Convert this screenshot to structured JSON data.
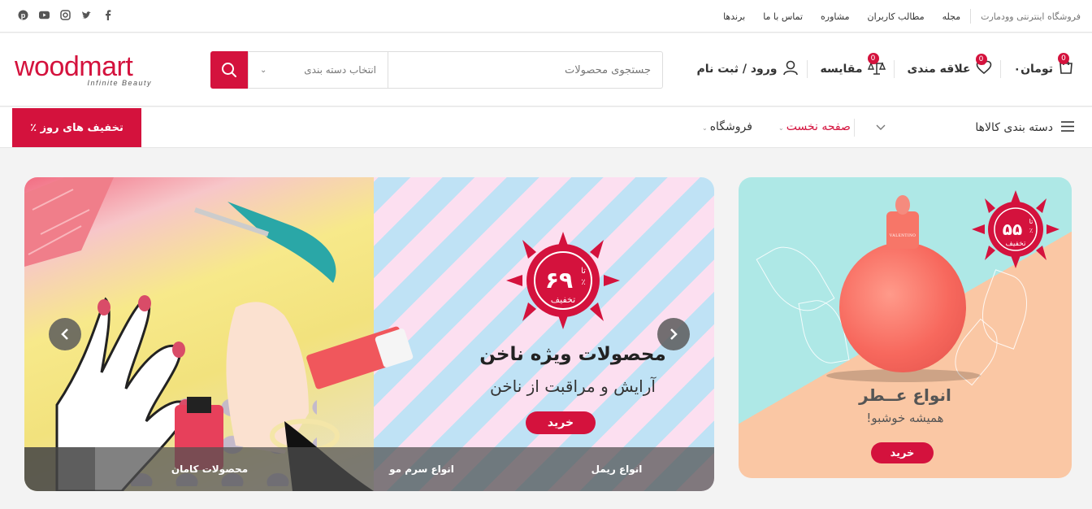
{
  "topbar": {
    "links": [
      "فروشگاه اینترنتی وودمارت",
      "مجله",
      "مطالب کاربران",
      "مشاوره",
      "تماس با ما",
      "برندها"
    ],
    "social_icons": [
      "facebook-icon",
      "twitter-icon",
      "instagram-icon",
      "youtube-icon",
      "pinterest-icon"
    ]
  },
  "header": {
    "logo_word": "woodmart",
    "logo_tagline": "Infinite Beauty",
    "search_placeholder": "جستجوی محصولات",
    "category_select": "انتخاب دسته بندی",
    "cart_label": "۰تومان",
    "cart_count": "0",
    "wishlist_label": "علاقه مندی",
    "wishlist_count": "0",
    "compare_label": "مقایسه",
    "compare_count": "0",
    "account_label": "ورود / ثبت نام"
  },
  "nav": {
    "categories_label": "دسته بندی کالاها",
    "home_label": "صفحه نخست",
    "shop_label": "فروشگاه",
    "deal_label": "٪ تخفیف های روز"
  },
  "main_banner": {
    "discount_number": "۶۹",
    "discount_prefix": "تا",
    "discount_percent": "٪",
    "discount_word": "تخفیف",
    "title": "محصولات ویژه ناخن",
    "subtitle": "آرایش و مراقبت از ناخن",
    "buy_label": "خرید",
    "tabs": [
      "انواع ریمل",
      "انواع سرم مو",
      "محصولات کامان"
    ]
  },
  "side_banner": {
    "discount_number": "۵۵",
    "discount_prefix": "تا",
    "discount_percent": "٪",
    "discount_word": "تخفیف",
    "brand_on_bottle": "VALENTINO",
    "title": "انواع عــطر",
    "subtitle": "همیشه خوشبو!",
    "buy_label": "خرید"
  },
  "colors": {
    "accent": "#d4123d",
    "stripe_pink": "#fcdff0",
    "stripe_blue": "#bfe2f5",
    "mint": "#aee8e6",
    "peach": "#fac7a4"
  }
}
